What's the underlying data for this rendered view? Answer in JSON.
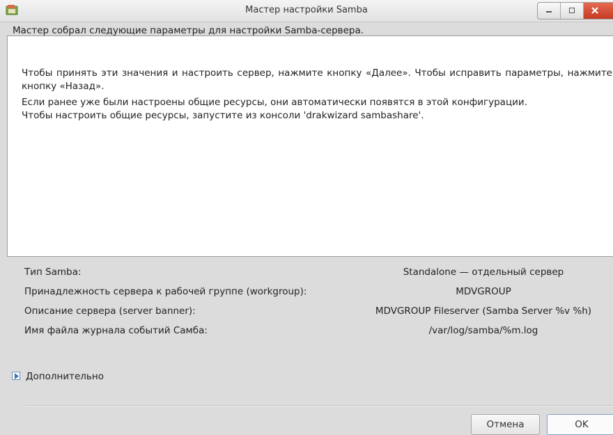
{
  "window": {
    "title": "Мастер настройки Samba",
    "icon": "samba-wizard-icon"
  },
  "intro": {
    "line1": "Мастер собрал следующие параметры для настройки Samba-сервера.",
    "line2": "Чтобы принять эти значения и настроить сервер, нажмите кнопку «Далее». Чтобы исправить параметры, нажмите кнопку «Назад».",
    "line3": "Если ранее уже были настроены общие ресурсы, они автоматически появятся в этой конфигурации.",
    "line4": "Чтобы настроить общие ресурсы, запустите из консоли 'drakwizard sambashare'."
  },
  "summary": [
    {
      "label": "Тип Samba:",
      "value": "Standalone — отдельный сервер"
    },
    {
      "label": "Принадлежность сервера к рабочей группе (workgroup):",
      "value": "MDVGROUP"
    },
    {
      "label": "Описание сервера (server banner):",
      "value": "MDVGROUP Fileserver (Samba Server %v %h)"
    },
    {
      "label": "Имя файла журнала событий Самба:",
      "value": "/var/log/samba/%m.log"
    }
  ],
  "expander": {
    "label": "Дополнительно",
    "expanded": false
  },
  "buttons": {
    "cancel": "Отмена",
    "ok": "OK"
  }
}
